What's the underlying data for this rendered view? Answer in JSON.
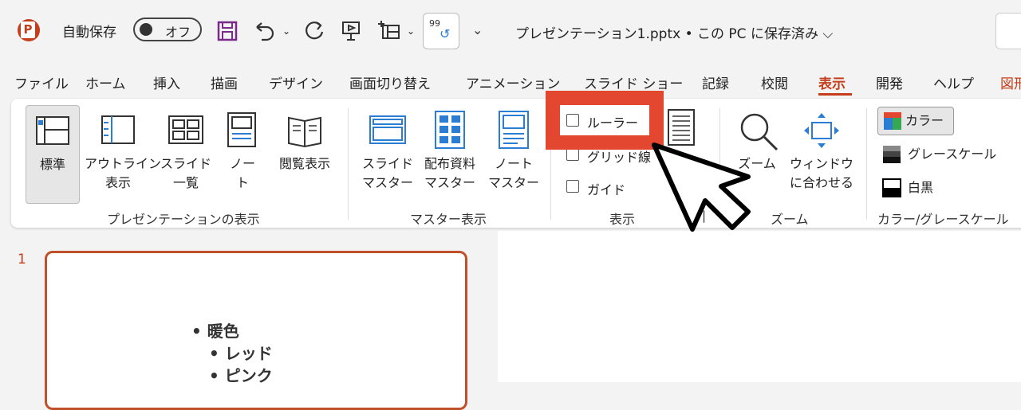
{
  "titlebar": {
    "autosave_label": "自動保存",
    "autosave_state": "オフ",
    "quick_num": "99",
    "file_title": "プレゼンテーション1.pptx • この PC に保存済み ⌵"
  },
  "tabs": [
    {
      "label": "ファイル"
    },
    {
      "label": "ホーム"
    },
    {
      "label": "挿入"
    },
    {
      "label": "描画"
    },
    {
      "label": "デザイン"
    },
    {
      "label": "画面切り替え"
    },
    {
      "label": "アニメーション"
    },
    {
      "label": "スライド ショー"
    },
    {
      "label": "記録"
    },
    {
      "label": "校閲"
    },
    {
      "label": "表示"
    },
    {
      "label": "開発"
    },
    {
      "label": "ヘルプ"
    },
    {
      "label": "図形"
    }
  ],
  "ribbon": {
    "presentation_views": {
      "group_label": "プレゼンテーションの表示",
      "normal": "標準",
      "outline_1": "アウトライン",
      "outline_2": "表示",
      "sorter_1": "スライド",
      "sorter_2": "一覧",
      "notes_1": "ノー",
      "notes_2": "ト",
      "reading": "閲覧表示"
    },
    "master_views": {
      "group_label": "マスター表示",
      "slide_master_1": "スライド",
      "slide_master_2": "マスター",
      "handout_1": "配布資料",
      "handout_2": "マスター",
      "notes_master_1": "ノート",
      "notes_master_2": "マスター"
    },
    "show": {
      "group_label": "表示",
      "ruler": "ルーラー",
      "gridlines": "グリッド線",
      "guides": "ガイド"
    },
    "zoom": {
      "group_label": "ズーム",
      "zoom": "ズーム",
      "fit_1": "ウィンドウ",
      "fit_2": "に合わせる"
    },
    "color": {
      "group_label": "カラー/グレースケール",
      "color": "カラー",
      "grayscale": "グレースケール",
      "bw": "白黒"
    }
  },
  "slide_panel": {
    "slide_number": "1",
    "bullets": [
      "暖色",
      "レッド",
      "ピンク"
    ]
  }
}
